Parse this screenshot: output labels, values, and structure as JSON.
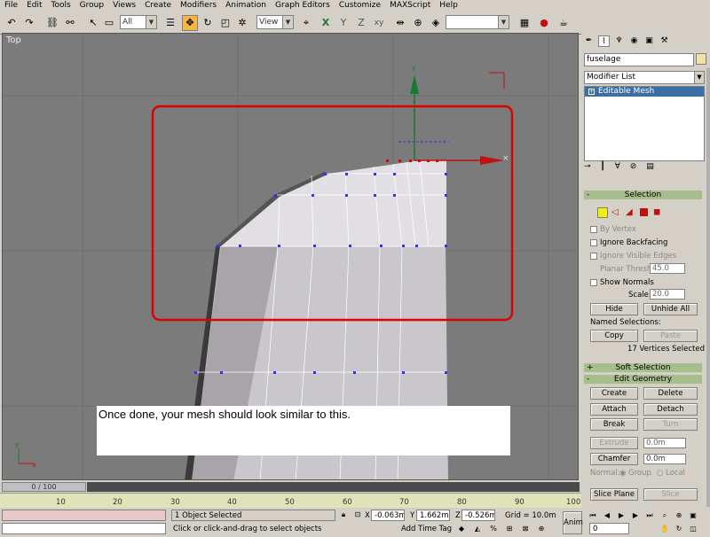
{
  "menu": [
    "File",
    "Edit",
    "Tools",
    "Group",
    "Views",
    "Create",
    "Modifiers",
    "Animation",
    "Graph Editors",
    "Customize",
    "MAXScript",
    "Help"
  ],
  "toolbar": {
    "selection_filter": "All",
    "ref_coord": "View",
    "named_selection": ""
  },
  "viewport": {
    "label": "Top",
    "caption": "Once done, your mesh should look similar to this."
  },
  "command_panel": {
    "object_name": "fuselage",
    "modifier_list": "Modifier List",
    "stack_item": "Editable Mesh",
    "selection_title": "Selection",
    "by_vertex": "By Vertex",
    "ignore_backfacing": "Ignore Backfacing",
    "ignore_visible_edges": "Ignore Visible Edges",
    "planar_thresh_label": "Planar Thresh:",
    "planar_thresh_value": "45.0",
    "show_normals": "Show Normals",
    "scale_label": "Scale:",
    "scale_value": "20.0",
    "hide": "Hide",
    "unhide_all": "Unhide All",
    "named_selections": "Named Selections:",
    "copy": "Copy",
    "paste": "Paste",
    "selected_count": "17 Vertices Selected",
    "soft_selection": "Soft Selection",
    "edit_geometry": "Edit Geometry",
    "create": "Create",
    "delete": "Delete",
    "attach": "Attach",
    "detach": "Detach",
    "break": "Break",
    "turn": "Turn",
    "extrude": "Extrude",
    "extrude_value": "0.0m",
    "chamfer": "Chamfer",
    "chamfer_value": "0.0m",
    "normal_label": "Normal:",
    "group": "Group",
    "local": "Local",
    "slice_plane": "Slice Plane",
    "slice": "Slice"
  },
  "timeline": {
    "slider": "0 / 100",
    "ticks": [
      "10",
      "20",
      "30",
      "40",
      "50",
      "60",
      "70",
      "80",
      "90",
      "100"
    ]
  },
  "status": {
    "selected": "1 Object Selected",
    "prompt": "Click or click-and-drag to select objects",
    "x_label": "X",
    "x": "-0.063m",
    "y_label": "Y",
    "y": "1.662m",
    "z_label": "Z",
    "z": "-0.526m",
    "grid": "Grid = 10.0m",
    "add_time_tag": "Add Time Tag",
    "anim": "Anim",
    "frame": "0"
  },
  "colors": {
    "highlight_box": "#e00000",
    "vertex": "#3030ff",
    "gizmo_y": "#1a7a30",
    "gizmo_x": "#c01010",
    "active_tool": "#f7b745",
    "rollout": "#a6be8c"
  }
}
